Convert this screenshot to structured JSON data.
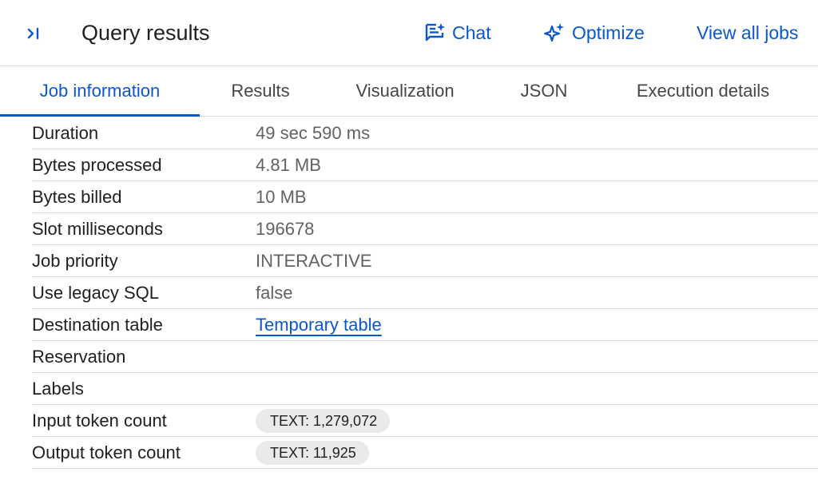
{
  "header": {
    "title": "Query results",
    "collapse_icon": "collapse-panel-icon",
    "actions": {
      "chat": {
        "label": "Chat",
        "icon": "chat-spark-icon"
      },
      "optimize": {
        "label": "Optimize",
        "icon": "sparkle-icon"
      },
      "view_all_jobs": {
        "label": "View all jobs"
      }
    }
  },
  "tabs": [
    {
      "label": "Job information",
      "active": true
    },
    {
      "label": "Results",
      "active": false
    },
    {
      "label": "Visualization",
      "active": false
    },
    {
      "label": "JSON",
      "active": false
    },
    {
      "label": "Execution details",
      "active": false
    }
  ],
  "job_info": {
    "rows": [
      {
        "label": "Duration",
        "value": "49 sec 590 ms"
      },
      {
        "label": "Bytes processed",
        "value": "4.81 MB"
      },
      {
        "label": "Bytes billed",
        "value": "10 MB"
      },
      {
        "label": "Slot milliseconds",
        "value": "196678"
      },
      {
        "label": "Job priority",
        "value": "INTERACTIVE"
      },
      {
        "label": "Use legacy SQL",
        "value": "false"
      },
      {
        "label": "Destination table",
        "value": "Temporary table"
      },
      {
        "label": "Reservation",
        "value": ""
      },
      {
        "label": "Labels",
        "value": ""
      },
      {
        "label": "Input token count",
        "value": "TEXT: 1,279,072"
      },
      {
        "label": "Output token count",
        "value": "TEXT: 11,925"
      }
    ]
  },
  "colors": {
    "accent": "#0b57d0",
    "divider": "#dadce0",
    "chip_bg": "#e9eaeb",
    "muted_text": "#5f6368"
  }
}
